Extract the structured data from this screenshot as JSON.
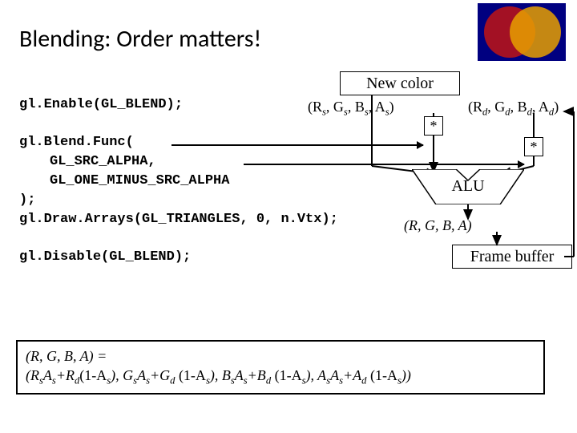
{
  "title": "Blending: Order matters!",
  "code": {
    "l1": "gl.Enable(GL_BLEND);",
    "l2": "gl.Blend.Func(",
    "l3": "GL_SRC_ALPHA,",
    "l4": "GL_ONE_MINUS_SRC_ALPHA",
    "l5": ");",
    "l6": "gl.Draw.Arrays(GL_TRIANGLES, 0, n.Vtx);",
    "l7": "gl.Disable(GL_BLEND);"
  },
  "diagram": {
    "newcolor": "New color",
    "mult": "*",
    "alu": "ALU",
    "framebuffer": "Frame buffer",
    "rgba_src_parts": [
      "(R",
      "s",
      ", G",
      "s",
      ", B",
      "s",
      ", A",
      "s",
      ")"
    ],
    "rgba_dst_parts": [
      "(R",
      "d",
      ", G",
      "d",
      ", B",
      "d",
      ", A",
      "d",
      ")"
    ],
    "rgba_out_parts": [
      "(R, G, B, A)"
    ]
  },
  "equation": {
    "lhs": "(R, G, B, A) =",
    "rhs_parts": [
      "(R",
      "s",
      "A",
      "s",
      "+R",
      "d",
      "(1-A",
      "s",
      "),  G",
      "s",
      "A",
      "s",
      "+G",
      "d",
      " (1-A",
      "s",
      "),  B",
      "s",
      "A",
      "s",
      "+B",
      "d",
      " (1-A",
      "s",
      "),  A",
      "s",
      "A",
      "s",
      "+A",
      "d",
      " (1-A",
      "s",
      "))"
    ]
  }
}
